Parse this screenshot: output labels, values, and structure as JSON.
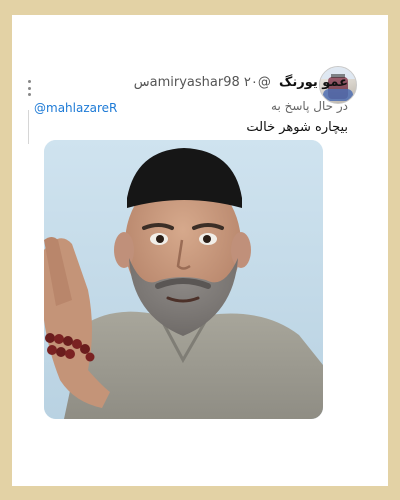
{
  "tweet": {
    "display_name": "عمو یورنگ",
    "handle": "@amiryashar98",
    "time": "۲۰س",
    "reply_label": "در حال پاسخ به",
    "reply_to": "@mahlazareR",
    "text": "بیچاره شوهر خالت"
  },
  "icons": {
    "avatar": "avatar",
    "more": "more-vertical-icon"
  },
  "colors": {
    "page_background": "#e3d2a5",
    "card_background": "#ffffff",
    "link": "#1d7ad6",
    "text": "#111111",
    "secondary_text": "#555555"
  }
}
